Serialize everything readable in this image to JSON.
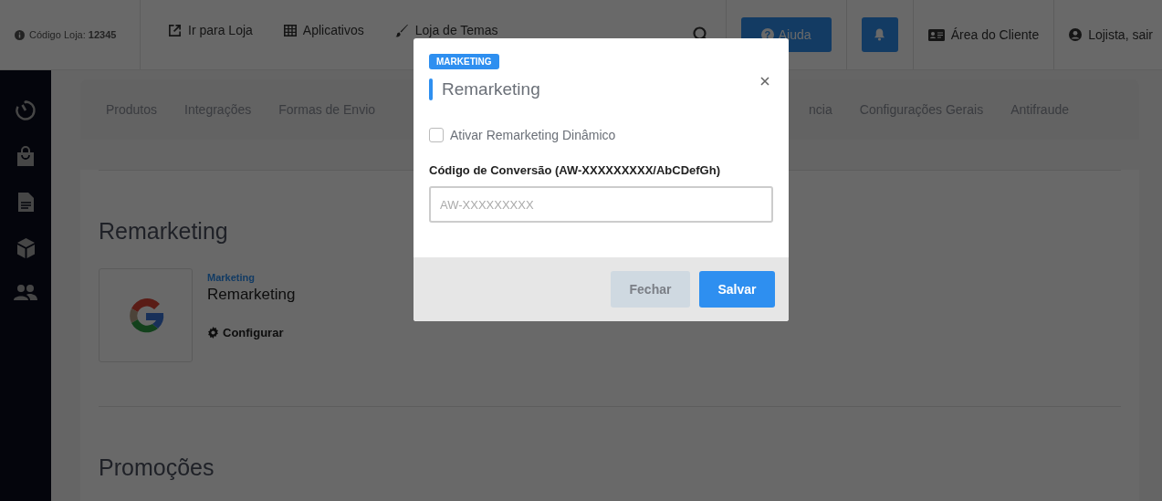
{
  "header": {
    "store_code": "Código Loja: **12345**",
    "links": [
      {
        "label": "Ir para Loja"
      },
      {
        "label": "Aplicativos"
      },
      {
        "label": "Loja de Temas"
      }
    ],
    "help_icon": "?",
    "help_button": "Ajuda",
    "client_area": "Área do Cliente",
    "user": "Lojista, sair"
  },
  "tabs": [
    {
      "label": "Produtos"
    },
    {
      "label": "Integrações"
    },
    {
      "label": "Formas de Envio"
    },
    {
      "label": "ncia"
    },
    {
      "label": "Configurações Gerais"
    },
    {
      "label": "Antifraude"
    }
  ],
  "sections": [
    {
      "title": "Remarketing",
      "apps": [
        {
          "category": "Marketing",
          "name": "Remarketing",
          "action": "Configurar"
        }
      ]
    },
    {
      "title": "Promoções"
    }
  ],
  "modal": {
    "badge": "MARKETING",
    "title": "Remarketing",
    "checkbox": {
      "label": "Ativar Remarketing Dinâmico",
      "checked": false
    },
    "field": {
      "label": "Código de Conversão (AW-XXXXXXXXX/AbCDefGh)",
      "placeholder": "AW-XXXXXXXXX"
    },
    "buttons": [
      {
        "label": "Fechar",
        "kind": "secondary"
      },
      {
        "label": "Salvar",
        "kind": "primary"
      }
    ]
  }
}
